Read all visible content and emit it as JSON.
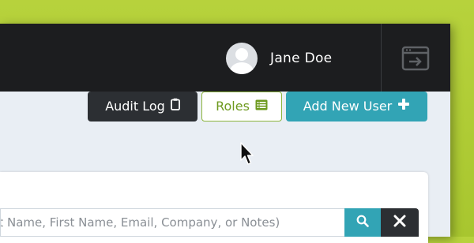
{
  "header": {
    "user_name": "Jane Doe",
    "avatar_icon": "user-avatar-icon",
    "exit_icon": "window-exit-icon"
  },
  "toolbar": {
    "audit_log_label": "Audit Log",
    "audit_log_icon": "clipboard-icon",
    "roles_label": "Roles",
    "roles_icon": "list-icon",
    "add_user_label": "Add New User",
    "add_user_icon": "plus-icon"
  },
  "search": {
    "placeholder": "Last Name, First Name, Email, Company, or Notes)",
    "search_icon": "search-icon",
    "clear_icon": "close-icon"
  },
  "colors": {
    "background_accent": "#b7d23c",
    "topbar": "#1c1d1f",
    "teal": "#32a4b5",
    "dark_button": "#2c2f33",
    "roles_green": "#6e9a1f"
  }
}
